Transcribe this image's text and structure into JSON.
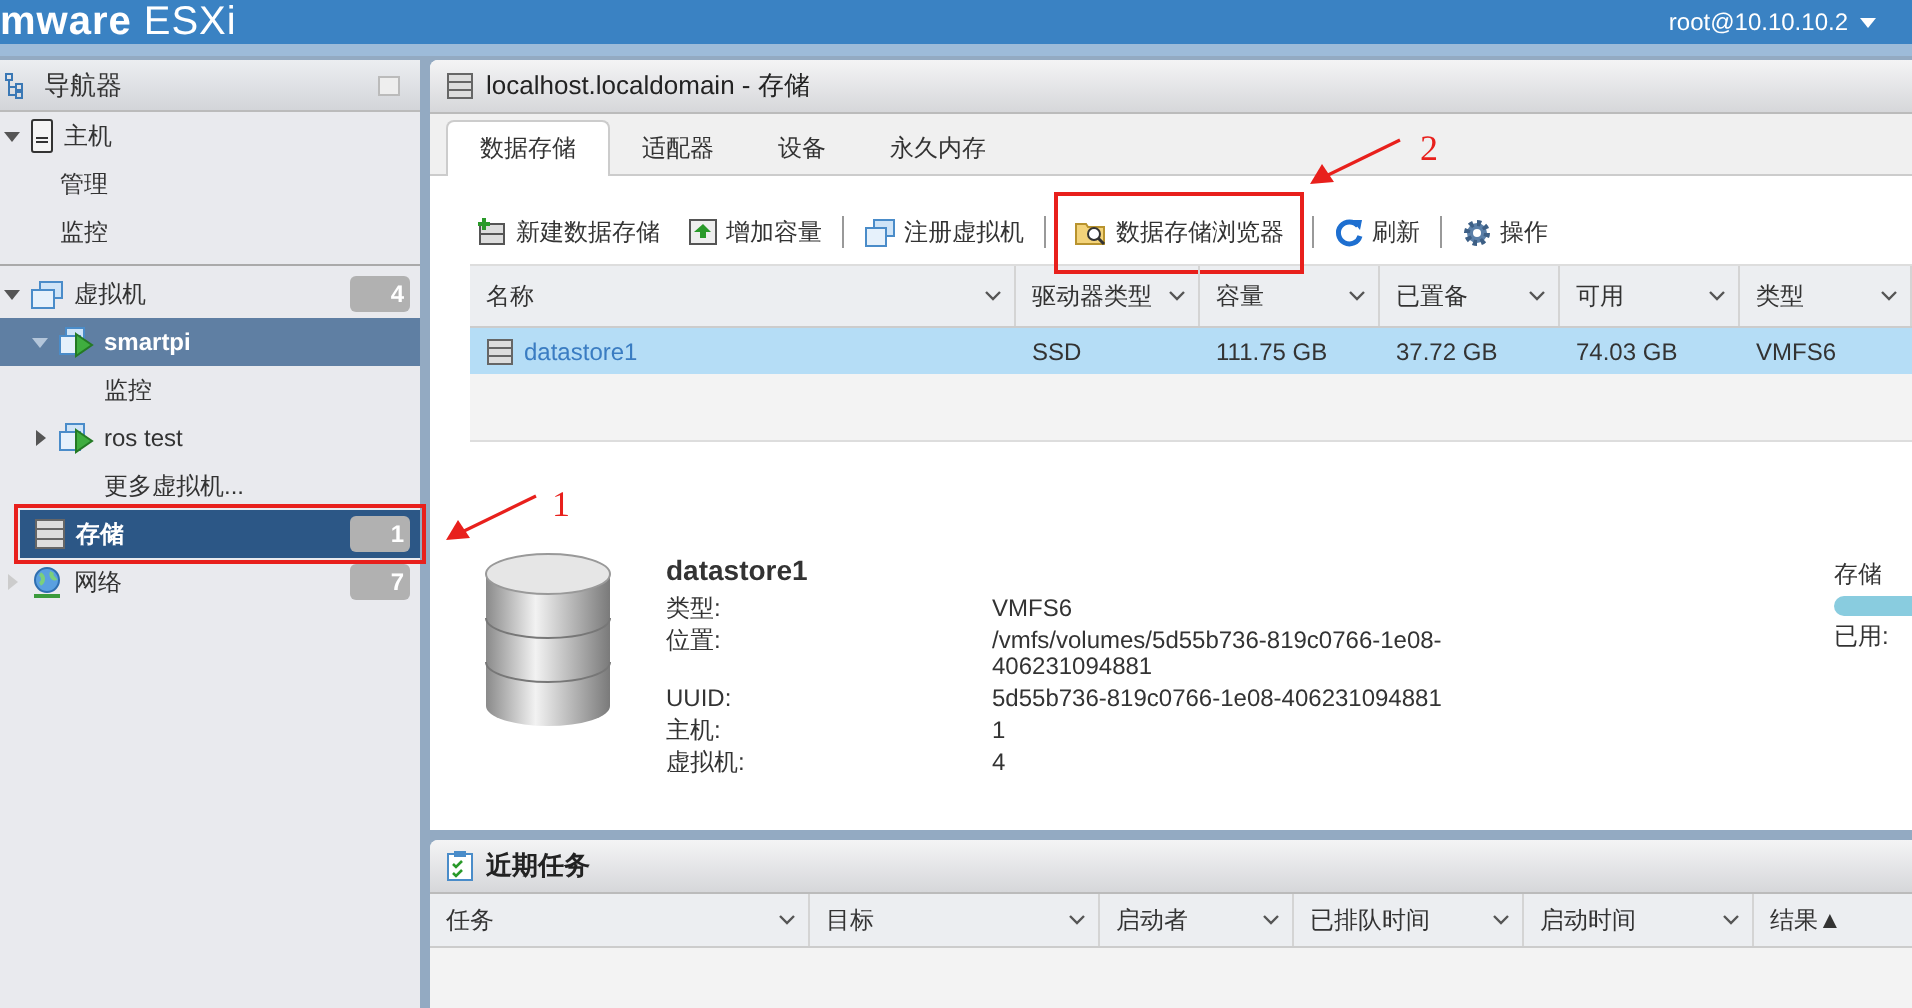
{
  "header": {
    "brand": "mware",
    "product": "ESXi",
    "user": "root@10.10.10.2"
  },
  "navigator": {
    "title": "导航器",
    "items": [
      {
        "kind": "host",
        "label": "主机",
        "expanded": true,
        "selected": false,
        "children": [
          {
            "kind": "link",
            "label": "管理",
            "selected": false
          },
          {
            "kind": "link",
            "label": "监控",
            "selected": false
          }
        ]
      },
      {
        "kind": "vms",
        "label": "虚拟机",
        "count": "4",
        "expanded": true,
        "selected": false,
        "children": [
          {
            "kind": "vm",
            "label": "smartpi",
            "expanded": true,
            "selected": true,
            "children": [
              {
                "kind": "link",
                "label": "监控",
                "selected": false
              }
            ]
          },
          {
            "kind": "vm",
            "label": "ros test",
            "expanded": false,
            "selected": false
          },
          {
            "kind": "link",
            "label": "更多虚拟机...",
            "selected": false
          }
        ]
      },
      {
        "kind": "storage",
        "label": "存储",
        "count": "1",
        "selected": true,
        "annotated": true
      },
      {
        "kind": "network",
        "label": "网络",
        "count": "7",
        "selected": false
      }
    ]
  },
  "main": {
    "title": "localhost.localdomain - 存储",
    "tabs": [
      {
        "label": "数据存储",
        "selected": true
      },
      {
        "label": "适配器",
        "selected": false
      },
      {
        "label": "设备",
        "selected": false
      },
      {
        "label": "永久内存",
        "selected": false
      }
    ],
    "toolbar": [
      {
        "kind": "new",
        "label": "新建数据存储"
      },
      {
        "kind": "grow",
        "label": "增加容量"
      },
      {
        "kind": "separator"
      },
      {
        "kind": "register",
        "label": "注册虚拟机"
      },
      {
        "kind": "separator"
      },
      {
        "kind": "browse",
        "label": "数据存储浏览器",
        "annotated": true
      },
      {
        "kind": "separator"
      },
      {
        "kind": "refresh",
        "label": "刷新"
      },
      {
        "kind": "separator"
      },
      {
        "kind": "actions",
        "label": "操作"
      }
    ],
    "table": {
      "columns": [
        "名称",
        "驱动器类型",
        "容量",
        "已置备",
        "可用",
        "类型"
      ],
      "rows": [
        {
          "selected": true,
          "cells": [
            "datastore1",
            "SSD",
            "111.75 GB",
            "37.72 GB",
            "74.03 GB",
            "VMFS6"
          ]
        }
      ]
    },
    "details": {
      "name": "datastore1",
      "fields": [
        {
          "label": "类型:",
          "value": "VMFS6"
        },
        {
          "label": "位置:",
          "value": "/vmfs/volumes/5d55b736-819c0766-1e08-406231094881"
        },
        {
          "label": "UUID:",
          "value": "5d55b736-819c0766-1e08-406231094881"
        },
        {
          "label": "主机:",
          "value": "1"
        },
        {
          "label": "虚拟机:",
          "value": "4"
        }
      ],
      "storage_label": "存储",
      "used_label": "已用:"
    }
  },
  "tasks": {
    "title": "近期任务",
    "columns": [
      {
        "label": "任务"
      },
      {
        "label": "目标"
      },
      {
        "label": "启动者"
      },
      {
        "label": "已排队时间"
      },
      {
        "label": "启动时间"
      },
      {
        "label": "结果",
        "sort": "▲"
      }
    ]
  },
  "annotations": [
    {
      "label": "1"
    },
    {
      "label": "2"
    }
  ]
}
